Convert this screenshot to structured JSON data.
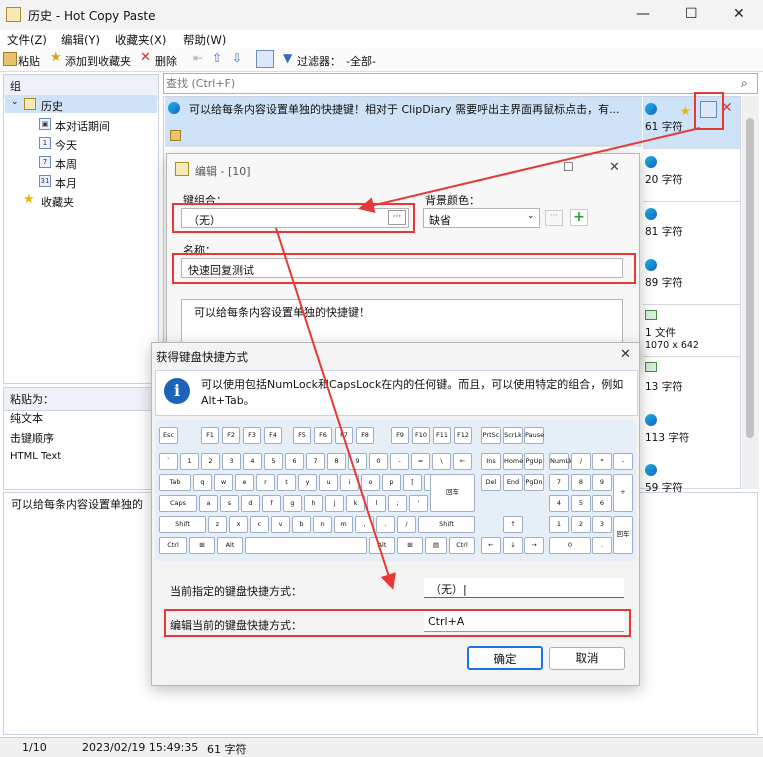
{
  "window": {
    "title": "历史 - Hot Copy Paste",
    "minimize": "—",
    "maximize": "☐",
    "close": "✕"
  },
  "menu": [
    "文件(Z)",
    "编辑(Y)",
    "收藏夹(X)",
    "帮助(W)"
  ],
  "toolbar": {
    "paste": "粘贴",
    "add_favorite": "添加到收藏夹",
    "delete": "删除",
    "filter": "过滤器：",
    "filter_value": "-全部-"
  },
  "left": {
    "group_header": "组",
    "history": "历史",
    "this_session": "本对话期间",
    "today": "今天",
    "this_week": "本周",
    "this_month": "本月",
    "favorites": "收藏夹",
    "paste_as_header": "粘贴为：",
    "paste_as": [
      "纯文本",
      "击键顺序",
      "HTML Text"
    ]
  },
  "search": {
    "placeholder": "查找 (Ctrl+F)"
  },
  "list": {
    "first_row_text": "可以给每条内容设置单独的快捷键！相对于 ClipDiary 需要呼出主界面再鼠标点击，有...",
    "counts": [
      "61 字符",
      "20 字符",
      "81 字符",
      "89 字符",
      "1 文件",
      "1070 x 642",
      "13 字符",
      "113 字符",
      "59 字符"
    ]
  },
  "preview": {
    "text": "可以给每条内容设置单独的"
  },
  "edit_dialog": {
    "title": "编辑 - [10]",
    "key_combo_label": "键组合：",
    "key_combo_value": "（无）",
    "bg_color_label": "背景颜色：",
    "bg_color_value": "缺省",
    "name_label": "名称：",
    "name_value": "快速回复测试",
    "content": "可以给每条内容设置单独的快捷键！"
  },
  "shortcut_dialog": {
    "title": "获得键盘快捷方式",
    "info": "可以使用包括NumLock和CapsLock在内的任何键。而且，可以使用特定的组合，例如Alt+Tab。",
    "current_label": "当前指定的键盘快捷方式：",
    "current_value": "（无）|",
    "edit_label": "编辑当前的键盘快捷方式：",
    "edit_value": "Ctrl+A",
    "ok": "确定",
    "cancel": "取消"
  },
  "status": {
    "position": "1/10",
    "datetime": "2023/02/19 15:49:35",
    "chars": "61 字符"
  },
  "colors": {
    "highlight_red": "#e53935",
    "selected_row": "#cfe3f8",
    "accent_blue": "#1a73e8"
  }
}
